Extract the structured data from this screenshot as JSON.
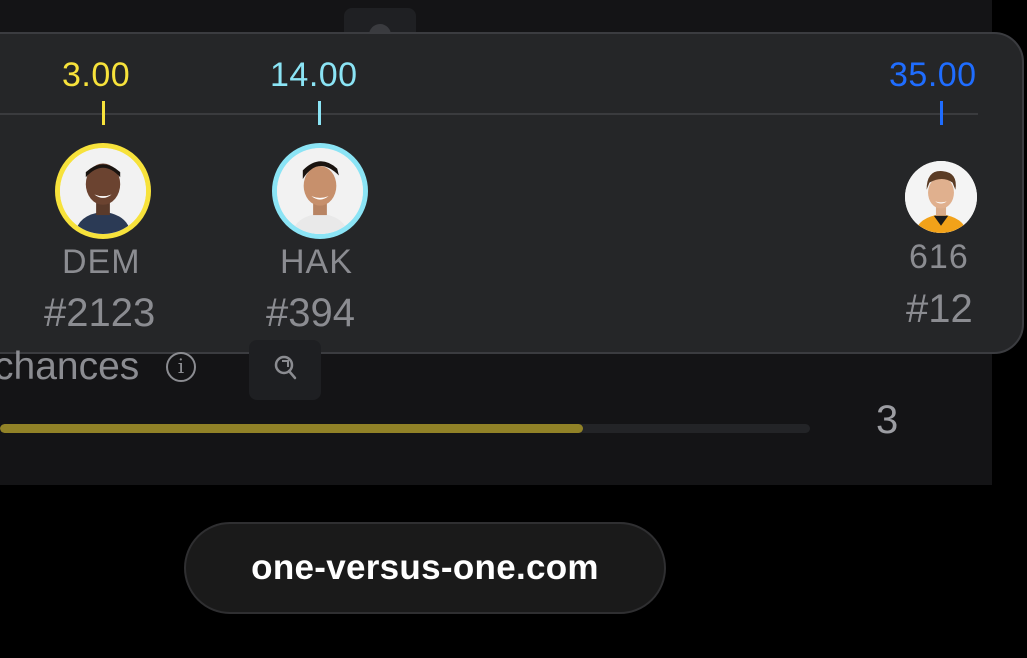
{
  "players": [
    {
      "value": "3.00",
      "abbr": "DEM",
      "rank": "#2123",
      "color": "#f7e23b"
    },
    {
      "value": "14.00",
      "abbr": "HAK",
      "rank": "#394",
      "color": "#8be4f5"
    },
    {
      "value": "35.00",
      "abbr": "616",
      "rank": "#12",
      "color": "#1f6dff"
    }
  ],
  "stat": {
    "label": "chances",
    "info_icon": "i",
    "count": "3",
    "progress": 0.72,
    "bar_color": "#918227"
  },
  "footer": {
    "url": "one-versus-one.com"
  }
}
